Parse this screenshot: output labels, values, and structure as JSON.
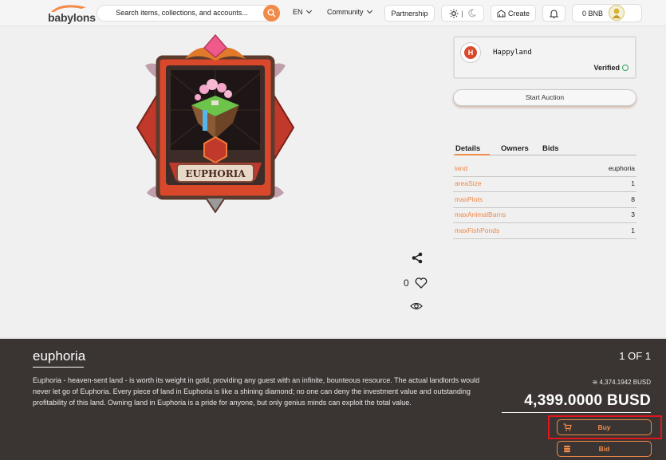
{
  "header": {
    "logo_text": "babylons",
    "search_placeholder": "Search items, collections, and accounts...",
    "language": "EN",
    "community_label": "Community",
    "partnership_label": "Partnership",
    "theme_separator": "|",
    "create_label": "Create",
    "balance": "0 BNB"
  },
  "owner": {
    "avatar_letter": "H",
    "name": "Happyland",
    "verified_label": "Verified"
  },
  "start_auction_label": "Start Auction",
  "card_name": "EUPHORIA",
  "tabs": [
    {
      "label": "Details",
      "active": true
    },
    {
      "label": "Owners",
      "active": false
    },
    {
      "label": "Bids",
      "active": false
    }
  ],
  "details": [
    {
      "key": "land",
      "value": "euphoria"
    },
    {
      "key": "areaSize",
      "value": "1"
    },
    {
      "key": "maxPlots",
      "value": "8"
    },
    {
      "key": "maxAnimalBarns",
      "value": "3"
    },
    {
      "key": "maxFishPonds",
      "value": "1"
    }
  ],
  "like_count": "0",
  "nft": {
    "title": "euphoria",
    "description": "Euphoria - heaven-sent land - is worth its weight in gold, providing any guest with an infinite, bounteous resource. The actual landlords would never let go of Euphoria. Every piece of land in Euphoria is like a shining diamond; no one can deny the investment value and outstanding profitability of this land. Owning land in Euphoria is a pride for anyone, but only genius minds can exploit the total value.",
    "edition": "1 OF 1",
    "usd_approx": "4,374.1942 BUSD",
    "price": "4,399.0000 BUSD",
    "buy_label": "Buy",
    "bid_label": "Bid"
  },
  "colors": {
    "accent": "#f28a48",
    "panel": "#3a3532",
    "highlight": "#e4141b"
  }
}
